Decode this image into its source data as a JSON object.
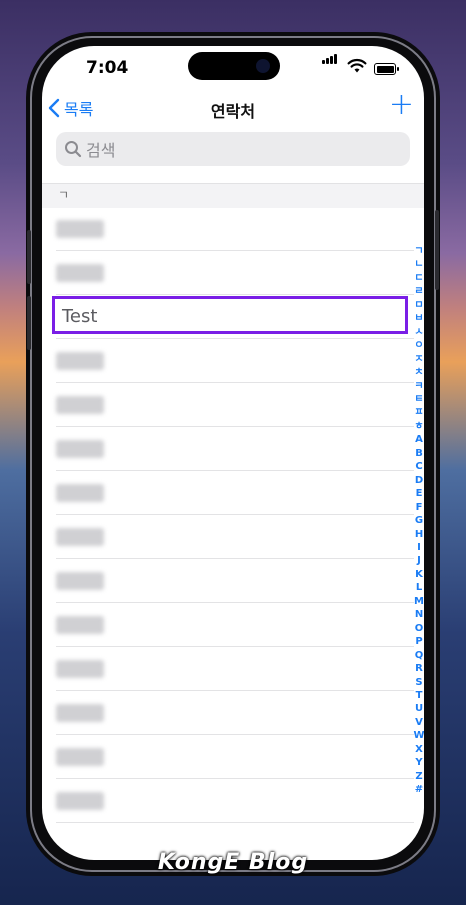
{
  "status": {
    "time": "7:04"
  },
  "nav": {
    "back_label": "목록",
    "title": "연락처",
    "add_label": "+"
  },
  "search": {
    "placeholder": "검색"
  },
  "section": {
    "header": "ㄱ"
  },
  "contacts": {
    "highlighted_name": "Test"
  },
  "index_letters": [
    "ㄱ",
    "ㄴ",
    "ㄷ",
    "ㄹ",
    "ㅁ",
    "ㅂ",
    "ㅅ",
    "ㅇ",
    "ㅈ",
    "ㅊ",
    "ㅋ",
    "ㅌ",
    "ㅍ",
    "ㅎ",
    "A",
    "B",
    "C",
    "D",
    "E",
    "F",
    "G",
    "H",
    "I",
    "J",
    "K",
    "L",
    "M",
    "N",
    "O",
    "P",
    "Q",
    "R",
    "S",
    "T",
    "U",
    "V",
    "W",
    "X",
    "Y",
    "Z",
    "#"
  ],
  "watermark": "KongE Blog",
  "colors": {
    "accent": "#1a7cf4",
    "highlight_border": "#7a1ee6"
  },
  "icons": {
    "back": "chevron-left-icon",
    "search": "search-icon",
    "add": "plus-icon"
  }
}
